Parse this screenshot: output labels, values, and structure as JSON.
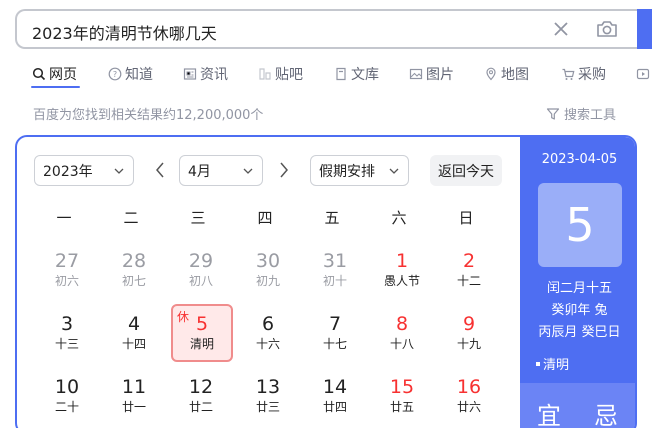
{
  "search": {
    "query": "2023年的清明节休哪几天"
  },
  "tabs": [
    {
      "label": "网页",
      "icon": "search-icon"
    },
    {
      "label": "知道",
      "icon": "question-icon"
    },
    {
      "label": "资讯",
      "icon": "news-icon"
    },
    {
      "label": "贴吧",
      "icon": "tieba-icon"
    },
    {
      "label": "文库",
      "icon": "doc-icon"
    },
    {
      "label": "图片",
      "icon": "image-icon"
    },
    {
      "label": "地图",
      "icon": "map-icon"
    },
    {
      "label": "采购",
      "icon": "cart-icon"
    }
  ],
  "results": {
    "count_text": "百度为您找到相关结果约12,200,000个",
    "tools_label": "搜索工具"
  },
  "calendar": {
    "year_select": "2023年",
    "month_select": "4月",
    "holiday_select": "假期安排",
    "today_button": "返回今天",
    "weekdays": [
      "一",
      "二",
      "三",
      "四",
      "五",
      "六",
      "日"
    ],
    "rows": [
      [
        {
          "num": "27",
          "lunar": "初六",
          "type": "other"
        },
        {
          "num": "28",
          "lunar": "初七",
          "type": "other"
        },
        {
          "num": "29",
          "lunar": "初八",
          "type": "other"
        },
        {
          "num": "30",
          "lunar": "初九",
          "type": "other"
        },
        {
          "num": "31",
          "lunar": "初十",
          "type": "other"
        },
        {
          "num": "1",
          "lunar": "愚人节",
          "type": "red-festival"
        },
        {
          "num": "2",
          "lunar": "十二",
          "type": "red"
        }
      ],
      [
        {
          "num": "3",
          "lunar": "十三",
          "type": "normal"
        },
        {
          "num": "4",
          "lunar": "十四",
          "type": "normal"
        },
        {
          "num": "5",
          "lunar": "清明",
          "type": "selected",
          "badge": "休"
        },
        {
          "num": "6",
          "lunar": "十六",
          "type": "normal"
        },
        {
          "num": "7",
          "lunar": "十七",
          "type": "normal"
        },
        {
          "num": "8",
          "lunar": "十八",
          "type": "red"
        },
        {
          "num": "9",
          "lunar": "十九",
          "type": "red"
        }
      ],
      [
        {
          "num": "10",
          "lunar": "二十",
          "type": "normal"
        },
        {
          "num": "11",
          "lunar": "廿一",
          "type": "normal"
        },
        {
          "num": "12",
          "lunar": "廿二",
          "type": "normal"
        },
        {
          "num": "13",
          "lunar": "廿三",
          "type": "normal"
        },
        {
          "num": "14",
          "lunar": "廿四",
          "type": "normal"
        },
        {
          "num": "15",
          "lunar": "廿五",
          "type": "red"
        },
        {
          "num": "16",
          "lunar": "廿六",
          "type": "red"
        }
      ]
    ]
  },
  "side": {
    "date": "2023-04-05",
    "day": "5",
    "lunar_date": "闰二月十五",
    "year_ganzhi": "癸卯年 兔",
    "month_day_ganzhi": "丙辰月 癸巳日",
    "festival": "清明",
    "yi": "宜",
    "ji": "忌"
  },
  "colors": {
    "accent": "#4e6ef2",
    "holiday_red": "#f73131"
  }
}
